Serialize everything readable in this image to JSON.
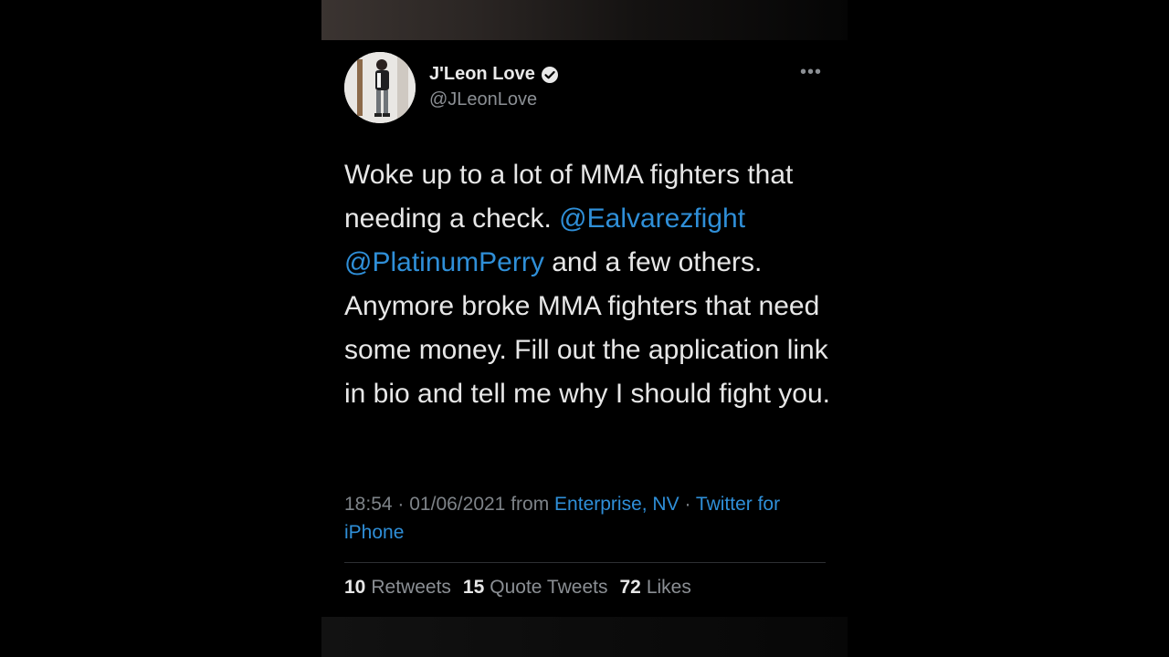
{
  "tweet": {
    "author_name": "J'Leon Love",
    "author_handle": "@JLeonLove",
    "more_label": "•••",
    "text_segments": [
      {
        "text": "Woke up to a lot of MMA fighters that needing a check. ",
        "mention": false
      },
      {
        "text": "@Ealvarezfight",
        "mention": true
      },
      {
        "text": " ",
        "mention": false
      },
      {
        "text": "@PlatinumPerry",
        "mention": true
      },
      {
        "text": " and a few others. Anymore broke MMA fighters that need some money. Fill out the application link in bio and tell me why I should fight you.",
        "mention": false
      }
    ],
    "time": "18:54",
    "separator": "·",
    "date": "01/06/2021",
    "from_label": "from",
    "location": "Enterprise, NV",
    "client": "Twitter for iPhone"
  },
  "stats": {
    "retweets_count": "10",
    "retweets_label": "Retweets",
    "quotes_count": "15",
    "quotes_label": "Quote Tweets",
    "likes_count": "72",
    "likes_label": "Likes"
  },
  "colors": {
    "background": "#000000",
    "text": "#e7e7e7",
    "muted": "#8b8f94",
    "link": "#2f8fd8"
  }
}
